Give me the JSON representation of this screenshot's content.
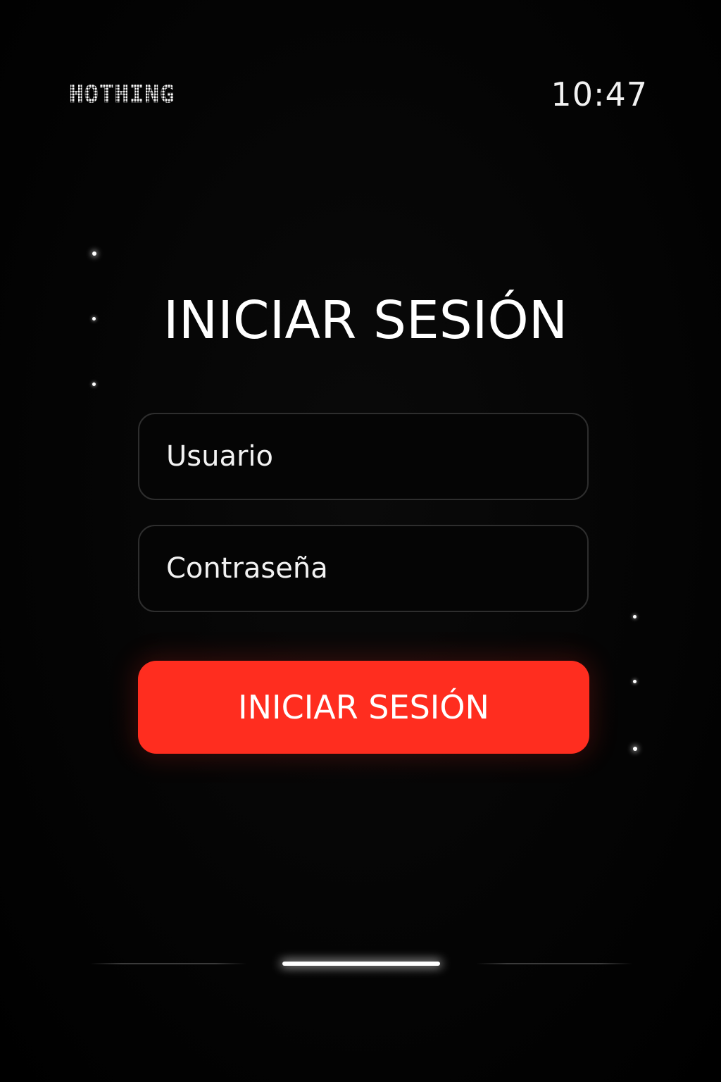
{
  "status_bar": {
    "brand": "HOTHING",
    "time": "10:47"
  },
  "login": {
    "title": "INICIAR SESIÓN",
    "username_placeholder": "Usuario",
    "password_placeholder": "Contraseña",
    "submit_label": "INICIAR SESIÓN"
  },
  "pager": {
    "page_count": 3,
    "active_index": 1
  },
  "colors": {
    "background": "#000000",
    "accent": "#ff2d1f",
    "text": "#ffffff",
    "field_border": "#2e2e2e"
  }
}
